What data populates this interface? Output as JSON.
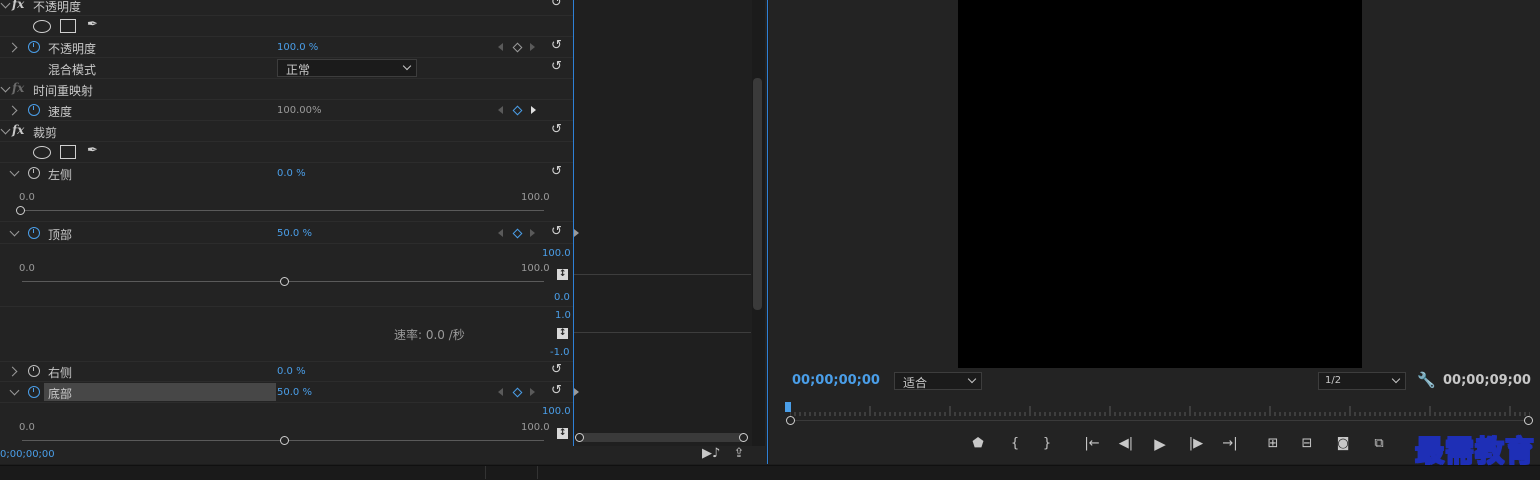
{
  "effects": {
    "opacity_group": {
      "title": "不透明度"
    },
    "opacity": {
      "label": "不透明度",
      "value": "100.0 %"
    },
    "blend": {
      "label": "混合模式",
      "value": "正常"
    },
    "time_remap_group": {
      "title": "时间重映射"
    },
    "speed": {
      "label": "速度",
      "value": "100.00%"
    },
    "crop_group": {
      "title": "裁剪"
    },
    "left": {
      "label": "左侧",
      "value": "0.0 %",
      "min": "0.0",
      "max": "100.0"
    },
    "top": {
      "label": "顶部",
      "value": "50.0 %",
      "min": "0.0",
      "max": "100.0"
    },
    "right": {
      "label": "右侧",
      "value": "0.0 %"
    },
    "bottom": {
      "label": "底部",
      "value": "50.0 %",
      "min": "0.0",
      "max": "100.0"
    },
    "rate_text": "速率: 0.0 /秒"
  },
  "graph": {
    "value_max": "100.0",
    "value_min": "0.0",
    "vel_max": "1.0",
    "vel_min": "-1.0",
    "bottom_value_max": "100.0"
  },
  "footer": {
    "timecode": "0;00;00;00"
  },
  "monitor": {
    "timecode_current": "00;00;00;00",
    "fit_label": "适合",
    "resolution": "1/2",
    "timecode_duration": "00;00;09;00"
  },
  "watermark": "最需教育",
  "colors": {
    "accent": "#4a9ee8",
    "panel": "#232323",
    "video": "#000000"
  }
}
